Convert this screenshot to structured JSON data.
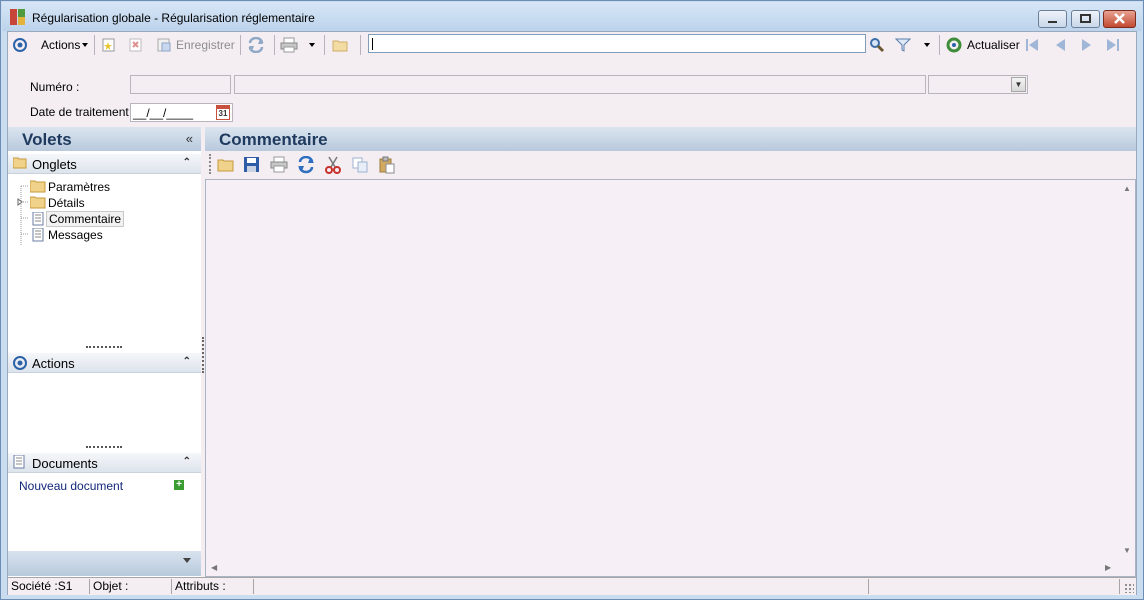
{
  "window": {
    "title": "Régularisation globale - Régularisation réglementaire",
    "minimize_icon": "minimize-icon",
    "maximize_icon": "maximize-icon",
    "close_icon": "close-icon"
  },
  "toolbar": {
    "actions_label": "Actions",
    "enregistrer_label": "Enregistrer",
    "actualiser_label": "Actualiser",
    "search_value": ""
  },
  "form": {
    "numero_label": "Numéro :",
    "numero_value": "",
    "numero_description": "",
    "numero_option": "",
    "date_label": "Date de traitement :",
    "date_value": "__/__/____",
    "calendar_day": "31"
  },
  "left_panel": {
    "title": "Volets",
    "collapse_symbol": "«",
    "onglets": {
      "title": "Onglets",
      "items": [
        {
          "label": "Paramètres",
          "icon": "folder-icon"
        },
        {
          "label": "Détails",
          "icon": "folder-icon"
        },
        {
          "label": "Commentaire",
          "icon": "document-icon",
          "selected": true
        },
        {
          "label": "Messages",
          "icon": "document-icon"
        }
      ]
    },
    "actions_section": {
      "title": "Actions"
    },
    "documents_section": {
      "title": "Documents",
      "new_document_label": "Nouveau document"
    }
  },
  "right_panel": {
    "title": "Commentaire",
    "editor_text": ""
  },
  "statusbar": {
    "societe": "Société :S1",
    "objet": "Objet :",
    "attributs": "Attributs :"
  },
  "colors": {
    "accent": "#1f3a5f",
    "panel_header": "#b8c9dc",
    "background": "#f4eef3",
    "link": "#12277a"
  }
}
